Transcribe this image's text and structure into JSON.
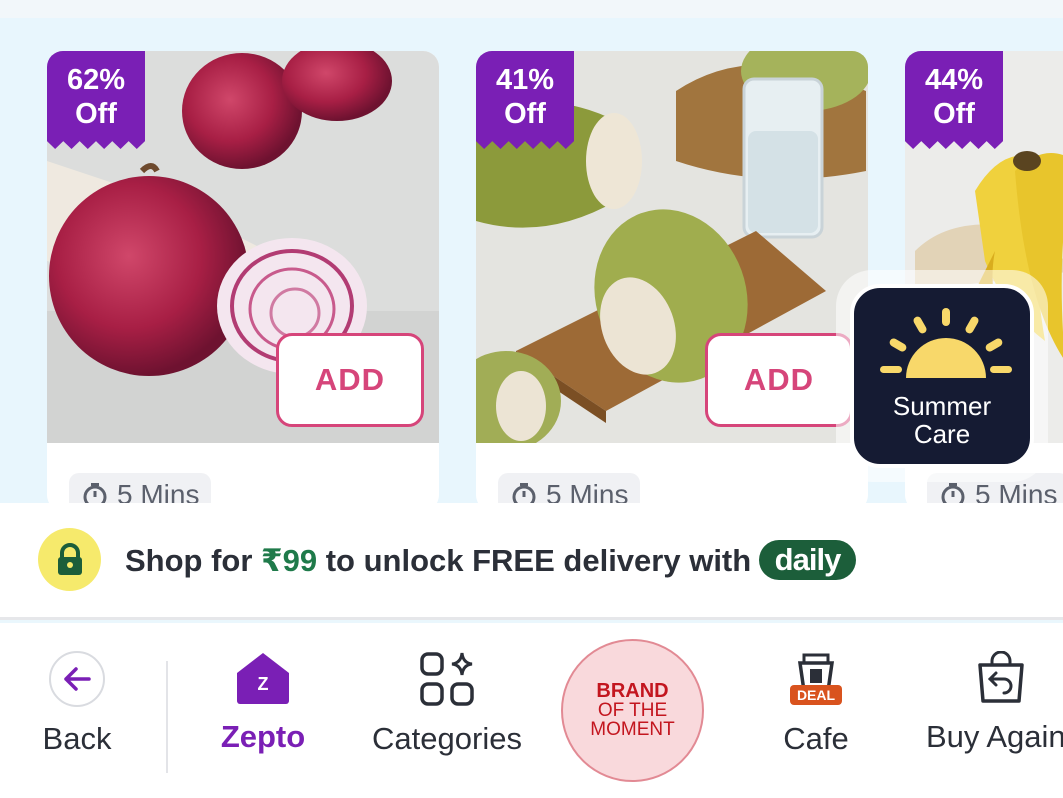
{
  "products": [
    {
      "discount_value": "62%",
      "discount_unit": "Off",
      "add_label": "ADD",
      "eta": "5 Mins"
    },
    {
      "discount_value": "41%",
      "discount_unit": "Off",
      "add_label": "ADD",
      "eta": "5 Mins"
    },
    {
      "discount_value": "44%",
      "discount_unit": "Off",
      "eta": "5 Mins"
    }
  ],
  "summer_care": {
    "line1": "Summer",
    "line2": "Care"
  },
  "free_delivery": {
    "prefix": "Shop for ",
    "amount": "₹99",
    "suffix": " to unlock FREE delivery with",
    "badge": "daily"
  },
  "bottom_nav": {
    "back": "Back",
    "zepto": "Zepto",
    "categories": "Categories",
    "brand_line1": "BRAND",
    "brand_line2": "OF THE",
    "brand_line3": "MOMENT",
    "cafe": "Cafe",
    "cafe_badge": "DEAL",
    "buy_again": "Buy Again",
    "zepto_badge": "Z"
  },
  "colors": {
    "accent_purple": "#7a1fb5",
    "add_pink": "#d6457a",
    "daily_green": "#1c5e3a",
    "brand_red": "#c3161f"
  }
}
